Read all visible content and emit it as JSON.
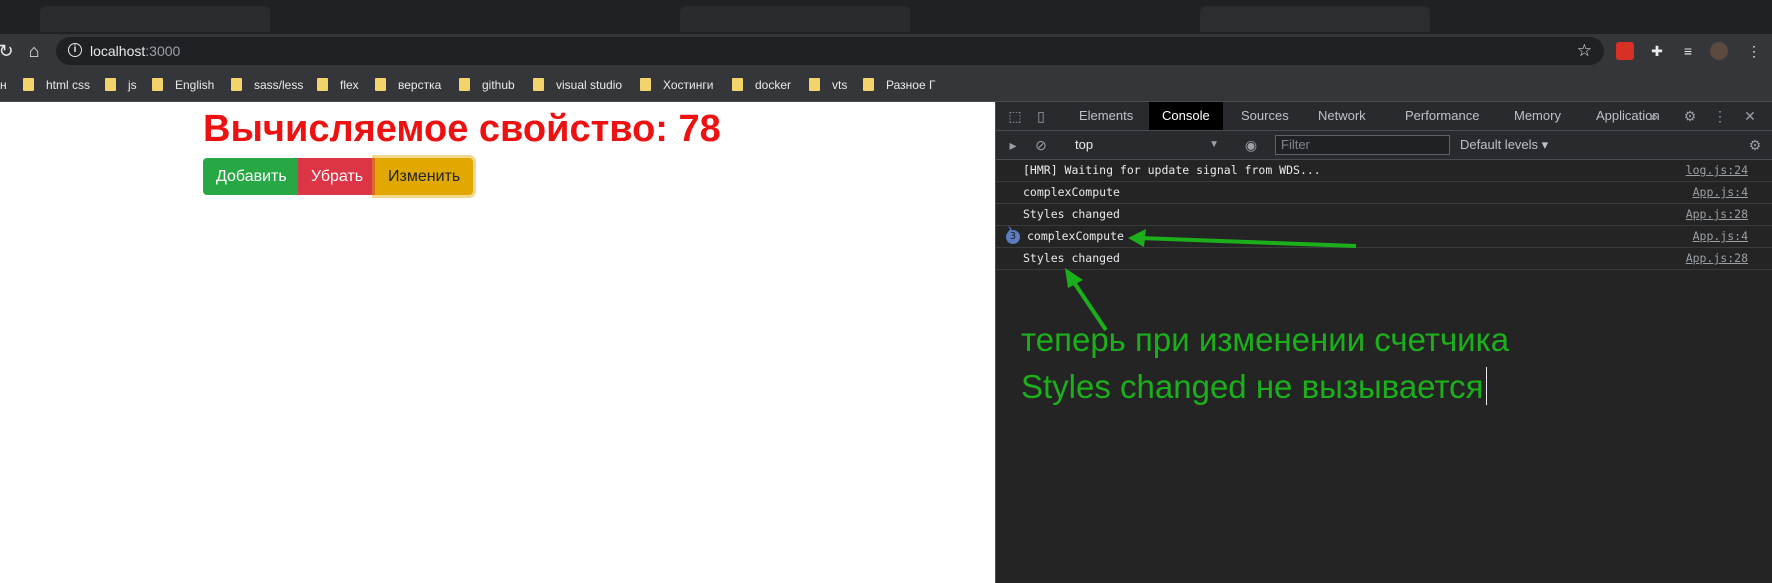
{
  "browser": {
    "url_host": "localhost",
    "url_port": ":3000",
    "bookmarks": [
      "н",
      "html css",
      "js",
      "English",
      "sass/less",
      "flex",
      "верстка",
      "github",
      "visual studio",
      "Хостинги",
      "docker",
      "vts",
      "Разное Г"
    ]
  },
  "page": {
    "heading": "Вычисляемое свойство: 78",
    "buttons": {
      "add": "Добавить",
      "remove": "Убрать",
      "change": "Изменить"
    }
  },
  "devtools": {
    "tabs": [
      "Elements",
      "Console",
      "Sources",
      "Network",
      "Performance",
      "Memory",
      "Application"
    ],
    "active_tab": "Console",
    "context": "top",
    "filter_placeholder": "Filter",
    "levels": "Default levels",
    "messages": [
      {
        "text": "[HMR] Waiting for update signal from WDS...",
        "source": "log.js:24"
      },
      {
        "text": "complexCompute",
        "source": "App.js:4"
      },
      {
        "text": "Styles changed",
        "source": "App.js:28"
      },
      {
        "text": "complexCompute",
        "source": "App.js:4",
        "count": "3"
      },
      {
        "text": "Styles changed",
        "source": "App.js:28"
      }
    ],
    "prompt": "›"
  },
  "annotation": {
    "line1": "теперь при изменении счетчика",
    "line2": "Styles changed не вызывается",
    "color": "#1bb01b"
  },
  "colors": {
    "heading": "#ee1111",
    "add_button": "#28a745",
    "remove_button": "#dc3545",
    "change_button": "#e0a800"
  }
}
